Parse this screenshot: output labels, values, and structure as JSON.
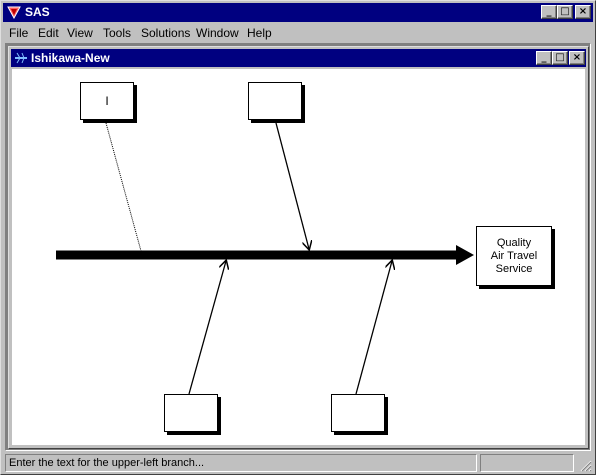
{
  "app": {
    "title": "SAS",
    "icon": "sas-app-icon"
  },
  "menu": {
    "items": [
      {
        "label": "File"
      },
      {
        "label": "Edit"
      },
      {
        "label": "View"
      },
      {
        "label": "Tools"
      },
      {
        "label": "Solutions"
      },
      {
        "label": "Window"
      },
      {
        "label": "Help"
      }
    ]
  },
  "document": {
    "title": "Ishikawa-New",
    "icon": "ishikawa-diagram-icon"
  },
  "diagram": {
    "effect_lines": [
      "Quality",
      "Air Travel",
      "Service"
    ],
    "branches": {
      "upper_left": "I",
      "upper_right": "",
      "lower_left": "",
      "lower_right": ""
    }
  },
  "status": {
    "message": "Enter the text for the upper-left branch..."
  },
  "colors": {
    "titlebar": "#000080",
    "face": "#c0c0c0",
    "canvas": "#ffffff"
  }
}
